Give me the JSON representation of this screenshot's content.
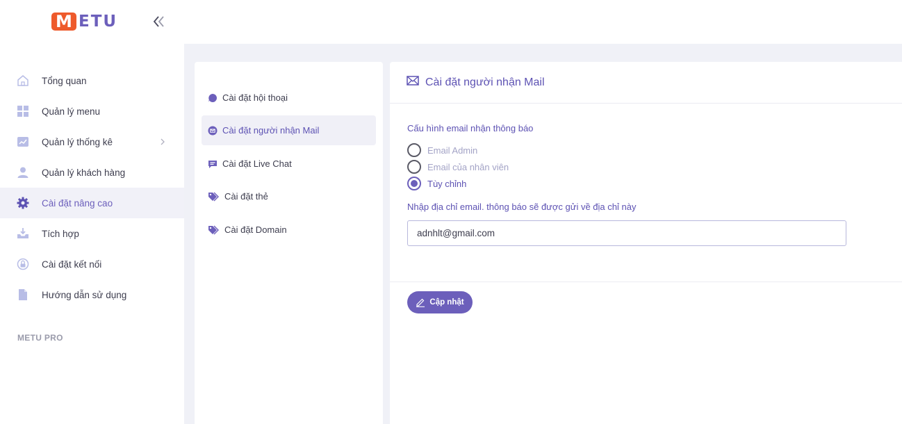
{
  "brand": {
    "logo_m": "M",
    "logo_rest": "ETU",
    "accent": "#6c5fbb",
    "logo_color": "#ee5a2b"
  },
  "sidebar": {
    "items": [
      {
        "label": "Tổng quan",
        "icon": "home-icon"
      },
      {
        "label": "Quản lý menu",
        "icon": "grid-icon"
      },
      {
        "label": "Quản lý thống kê",
        "icon": "chart-icon",
        "has_submenu": true
      },
      {
        "label": "Quản lý khách hàng",
        "icon": "user-icon"
      },
      {
        "label": "Cài đặt nâng cao",
        "icon": "gear-icon",
        "active": true
      },
      {
        "label": "Tích hợp",
        "icon": "download-tray-icon"
      },
      {
        "label": "Cài đặt kết nối",
        "icon": "lock-circle-icon"
      },
      {
        "label": "Hướng dẫn sử dụng",
        "icon": "document-icon"
      }
    ],
    "section_label": "METU PRO"
  },
  "subnav": {
    "items": [
      {
        "label": "Cài đặt hội thoại",
        "icon": "chat-bubble-icon"
      },
      {
        "label": "Cài đặt người nhận Mail",
        "icon": "mail-circle-icon",
        "active": true
      },
      {
        "label": "Cài đặt Live Chat",
        "icon": "comment-icon"
      },
      {
        "label": "Cài đặt thẻ",
        "icon": "tag-icon"
      },
      {
        "label": "Cài đặt Domain",
        "icon": "tag-icon"
      }
    ]
  },
  "main": {
    "title": "Cài đặt người nhận Mail",
    "config_label": "Cấu hình email nhận thông báo",
    "options": [
      {
        "label": "Email Admin",
        "checked": false
      },
      {
        "label": "Email của nhân viên",
        "checked": false
      },
      {
        "label": "Tùy chỉnh",
        "checked": true
      }
    ],
    "email_label": "Nhập địa chỉ email. thông báo sẽ được gửi về địa chỉ này",
    "email_value": "adnhlt@gmail.com",
    "update_button": "Cập nhật"
  }
}
